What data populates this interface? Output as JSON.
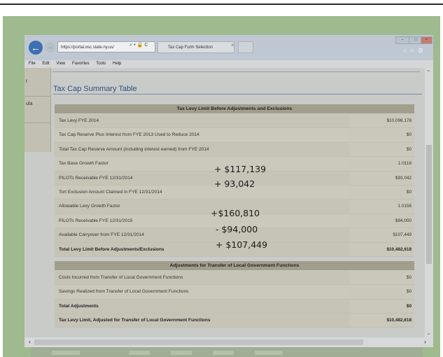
{
  "browser": {
    "url": "https://portal.osc.state.ny.us/",
    "tab_title": "Tax Cap Form Selection",
    "menu": [
      "File",
      "Edit",
      "View",
      "Favorites",
      "Tools",
      "Help"
    ]
  },
  "sidebar": {
    "items": [
      "t",
      "ula"
    ]
  },
  "page": {
    "title": "Tax Cap Summary Table"
  },
  "section1": {
    "header": "Tax Levy Limit Before Adjustments and Exclusions",
    "rows": [
      {
        "label": "Tax Levy FYE 2014",
        "value": "$10,098,178"
      },
      {
        "label": "Tax Cap Reserve Plus Interest from FYE 2013 Used to Reduce 2014",
        "value": "$0"
      },
      {
        "label": "Total Tax Cap Reserve Amount (including interest earned) from FYE 2014",
        "value": "$0"
      },
      {
        "label": "Tax Base Growth Factor",
        "value": "1.0116"
      },
      {
        "label": "PILOTs Receivable FYE 12/31/2014",
        "value": "$93,042"
      },
      {
        "label": "Tort Exclusion Amount Claimed in FYE 12/31/2014",
        "value": "$0"
      },
      {
        "label": "Allowable Levy Growth Factor",
        "value": "1.0156"
      },
      {
        "label": "PILOTs Receivable FYE 12/31/2015",
        "value": "$94,000"
      },
      {
        "label": "Available Carryover from FYE 12/31/2014",
        "value": "$107,449"
      },
      {
        "label": "Total Levy Limit Before Adjustments/Exclusions",
        "value": "$10,482,618"
      }
    ]
  },
  "section2": {
    "header": "Adjustments for Transfer of Local Government Functions",
    "rows": [
      {
        "label": "Costs Incurred from Transfer of Local Government Functions",
        "value": "$0"
      },
      {
        "label": "Savings Realized from Transfer of Local Government Functions",
        "value": "$0"
      },
      {
        "label": "Total Adjustments",
        "value": "$0"
      },
      {
        "label": "Tax Levy Limit, Adjusted for Transfer of Local Government Functions",
        "value": "$10,482,618"
      }
    ]
  },
  "annotations": [
    "+ $117,139",
    "+ 93,042",
    "+$160,810",
    "- $94,000",
    "+ $107,449"
  ]
}
